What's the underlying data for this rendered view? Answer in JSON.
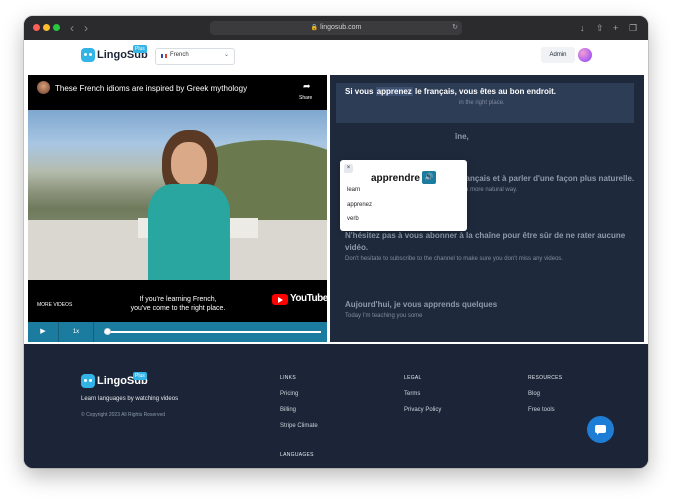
{
  "browser": {
    "url": "lingosub.com",
    "traffic_colors": [
      "#ff5f57",
      "#febc2e",
      "#28c840"
    ]
  },
  "header": {
    "logo_text": "LingoSub",
    "logo_badge": "Plus",
    "language": "French",
    "admin_label": "Admin"
  },
  "video": {
    "title": "These French idioms are inspired by Greek mythology",
    "share_label": "Share",
    "more_videos": "MORE VIDEOS",
    "caption_line1": "If you're learning French,",
    "caption_line2": "you've come to the right place.",
    "youtube_label": "YouTube",
    "speed": "1x",
    "progress": 0.0
  },
  "transcript": {
    "segments": [
      {
        "fr_before": "Si vous ",
        "fr_highlight": "apprenez",
        "fr_after": " le français, vous êtes au bon endroit.",
        "en": "If you're learning French, you've come to the right place."
      },
      {
        "fr": "Je m'appelle Léa et sur cette chaîne,",
        "en": ""
      },
      {
        "fr": "je vous aide à améliorer votre français et à parler d'une façon plus naturelle.",
        "en": "I help you improve your French and speak in a more natural way."
      },
      {
        "fr": "N'hésitez pas à vous abonner à la chaîne pour être sûr de ne rater aucune vidéo.",
        "en": "Don't hesitate to subscribe to the channel to make sure you don't miss any videos."
      },
      {
        "fr": "Aujourd'hui, je vous apprends quelques",
        "en": "Today I'm teaching you some"
      }
    ],
    "visible_fragment_seg1_en": "in the right place.",
    "visible_fragment_seg2": "îne,"
  },
  "popup": {
    "close": "×",
    "word": "apprendre",
    "translation": "learn",
    "form": "apprenez",
    "pos": "verb"
  },
  "footer": {
    "logo_text": "LingoSub",
    "logo_badge": "Plus",
    "tagline": "Learn languages by watching videos",
    "copyright": "© Copyright 2023 All Rights Reserved",
    "links_heading": "LINKS",
    "links": [
      "Pricing",
      "Billing",
      "Stripe Climate"
    ],
    "languages_heading": "LANGUAGES",
    "legal_heading": "LEGAL",
    "legal": [
      "Terms",
      "Privacy Policy"
    ],
    "resources_heading": "RESOURCES",
    "resources": [
      "Blog",
      "Free tools"
    ]
  }
}
